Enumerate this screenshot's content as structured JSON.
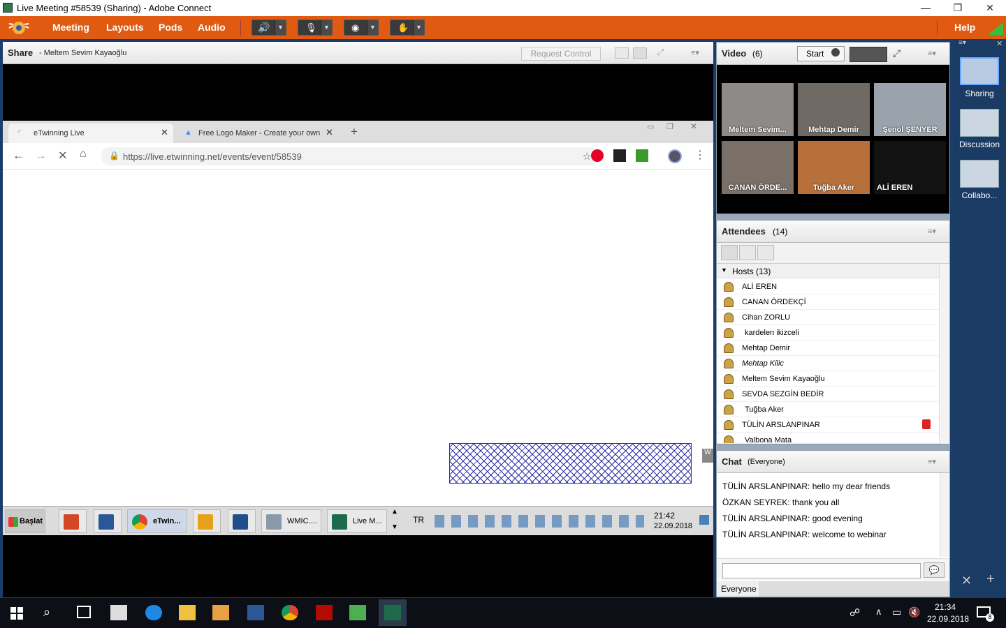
{
  "window": {
    "title": "Live Meeting #58539 (Sharing) - Adobe Connect"
  },
  "menu": {
    "items": [
      "Meeting",
      "Layouts",
      "Pods",
      "Audio"
    ],
    "help": "Help"
  },
  "share_pod": {
    "title": "Share",
    "presenter": "- Meltem Sevim Kayaoğlu",
    "request_control": "Request Control"
  },
  "browser": {
    "tabs": [
      {
        "label": "eTwinning Live"
      },
      {
        "label": "Free Logo Maker - Create your own"
      }
    ],
    "url": "https://live.etwinning.net/events/event/58539"
  },
  "inner_taskbar": {
    "start": "Başlat",
    "items": [
      "eTwin...",
      "WMIC....",
      "Live M..."
    ],
    "lang": "TR",
    "time": "21:42",
    "date": "22.09.2018"
  },
  "video_pod": {
    "title": "Video",
    "count": "(6)",
    "start_label": "Start",
    "participants": [
      "Meltem Sevim...",
      "Mehtap Demir",
      "Şenol ŞENYER",
      "CANAN ÖRDE...",
      "Tuğba  Aker",
      "ALİ EREN"
    ]
  },
  "attendees_pod": {
    "title": "Attendees",
    "count": "(14)",
    "group": "Hosts (13)",
    "hosts": [
      "ALİ EREN",
      "CANAN ÖRDEKÇİ",
      "Cihan ZORLU",
      "kardelen ikizceli",
      "Mehtap Demir",
      "Mehtap Kilic",
      "Meltem Sevim Kayaoğlu",
      "SEVDA SEZGİN BEDİR",
      "Tuğba  Aker",
      "TÜLİN ARSLANPINAR",
      "Valbona Mata"
    ]
  },
  "chat_pod": {
    "title": "Chat",
    "scope": "(Everyone)",
    "messages": [
      {
        "sender": "TÜLİN ARSLANPINAR:",
        "text": "hello my dear friends"
      },
      {
        "sender": "ÖZKAN SEYREK:",
        "text": "thank you all"
      },
      {
        "sender": "TÜLİN ARSLANPINAR:",
        "text": "good evening"
      },
      {
        "sender": "TÜLİN ARSLANPINAR:",
        "text": "welcome to webinar"
      }
    ],
    "recipient": "Everyone"
  },
  "layouts_panel": {
    "items": [
      "Sharing",
      "Discussion",
      "Collabo..."
    ]
  },
  "system_tray": {
    "time": "21:34",
    "date": "22.09.2018",
    "notifications": "8"
  },
  "colors": {
    "accent": "#e05a12",
    "dark_bg": "#1a3b63"
  }
}
